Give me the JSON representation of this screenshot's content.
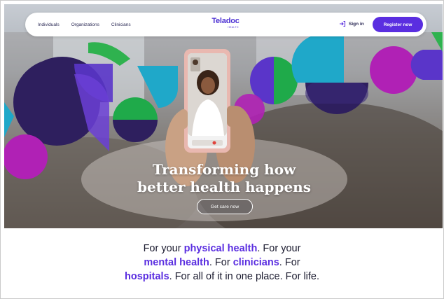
{
  "nav": {
    "links": [
      "Individuals",
      "Organizations",
      "Clinicians"
    ],
    "brand": "Teladoc",
    "brand_sub": "HEALTH",
    "signin": "Sign in",
    "register": "Register now"
  },
  "hero": {
    "headline_line1": "Transforming how",
    "headline_line2": "better health happens",
    "cta": "Get care now"
  },
  "tagline": {
    "p1": "For your ",
    "h1": "physical health",
    "p2": ". For your",
    "h2": "mental health",
    "p3": ". For ",
    "h3": "clinicians",
    "p4": ". For",
    "h4": "hospitals",
    "p5": ". For all of it in one place. For life."
  },
  "colors": {
    "accent": "#5a2ee0",
    "navy_shape": "#2e1f5e",
    "teal_shape": "#1fa8c9",
    "green_shape": "#1faa4a",
    "magenta_shape": "#b021b5"
  }
}
